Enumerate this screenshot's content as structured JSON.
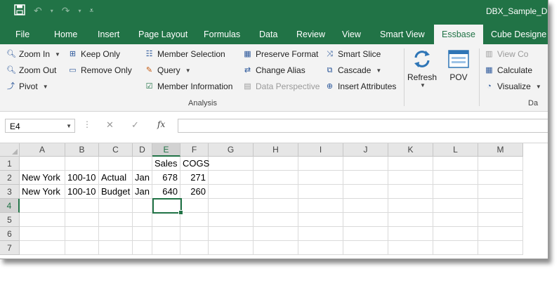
{
  "title_bar": {
    "doc_name": "DBX_Sample_D",
    "save_icon": "save-icon",
    "undo_icon": "undo-icon",
    "redo_icon": "redo-icon",
    "customize_icon": "customize-qat-icon"
  },
  "tabs": [
    "File",
    "Home",
    "Insert",
    "Page Layout",
    "Formulas",
    "Data",
    "Review",
    "View",
    "Smart View",
    "Essbase",
    "Cube Designe"
  ],
  "ribbon": {
    "zoom_in": "Zoom In",
    "zoom_out": "Zoom Out",
    "pivot": "Pivot",
    "keep_only": "Keep Only",
    "remove_only": "Remove Only",
    "member_selection": "Member Selection",
    "query": "Query",
    "member_information": "Member Information",
    "preserve_format": "Preserve Format",
    "change_alias": "Change Alias",
    "data_perspective": "Data Perspective",
    "smart_slice": "Smart Slice",
    "cascade": "Cascade",
    "insert_attributes": "Insert Attributes",
    "group_label": "Analysis",
    "refresh": "Refresh",
    "pov": "POV",
    "view_comments": "View Co",
    "calculate": "Calculate",
    "visualize": "Visualize",
    "group_label_2": "Da"
  },
  "formula_bar": {
    "name_box": "E4",
    "cancel": "✕",
    "enter": "✓",
    "fx": "fx",
    "value": ""
  },
  "grid": {
    "columns": [
      "A",
      "B",
      "C",
      "D",
      "E",
      "F",
      "G",
      "H",
      "I",
      "J",
      "K",
      "L",
      "M"
    ],
    "rows": [
      "1",
      "2",
      "3",
      "4",
      "5",
      "6",
      "7"
    ],
    "cells": {
      "E1": "Sales",
      "F1": "COGS",
      "A2": "New York",
      "B2": "100-10",
      "C2": "Actual",
      "D2": "Jan",
      "E2": "678",
      "F2": "271",
      "A3": "New York",
      "B3": "100-10",
      "C3": "Budget",
      "D3": "Jan",
      "E3": "640",
      "F3": "260"
    },
    "selected_cell": "E4"
  }
}
